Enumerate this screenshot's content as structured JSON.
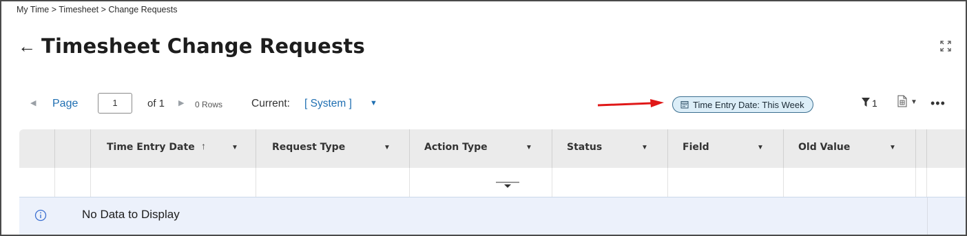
{
  "breadcrumb": {
    "text": "My Time > Timesheet > Change Requests"
  },
  "header": {
    "back_icon": "arrow-left-icon",
    "title": "Timesheet Change Requests",
    "expand_icon": "expand-icon"
  },
  "pagination": {
    "page_label": "Page",
    "page_value": "1",
    "of_label": "of 1",
    "rows_label": "0 Rows",
    "current_label": "Current:",
    "current_value": "[ System ]"
  },
  "filter_chip": {
    "label": "Time Entry Date: This Week",
    "icon": "calendar-icon"
  },
  "filter_count": "1",
  "columns": [
    {
      "label": "Time Entry Date",
      "sorted": "asc"
    },
    {
      "label": "Request Type"
    },
    {
      "label": "Action Type"
    },
    {
      "label": "Status"
    },
    {
      "label": "Field"
    },
    {
      "label": "Old Value"
    }
  ],
  "empty_message": "No Data to Display",
  "colors": {
    "accent": "#1f6fb2",
    "chip_bg": "#dceef8",
    "chip_border": "#3a6e8f",
    "annotation_arrow": "#e01818",
    "header_bg": "#ebebeb",
    "empty_bg": "#ecf1fb"
  }
}
